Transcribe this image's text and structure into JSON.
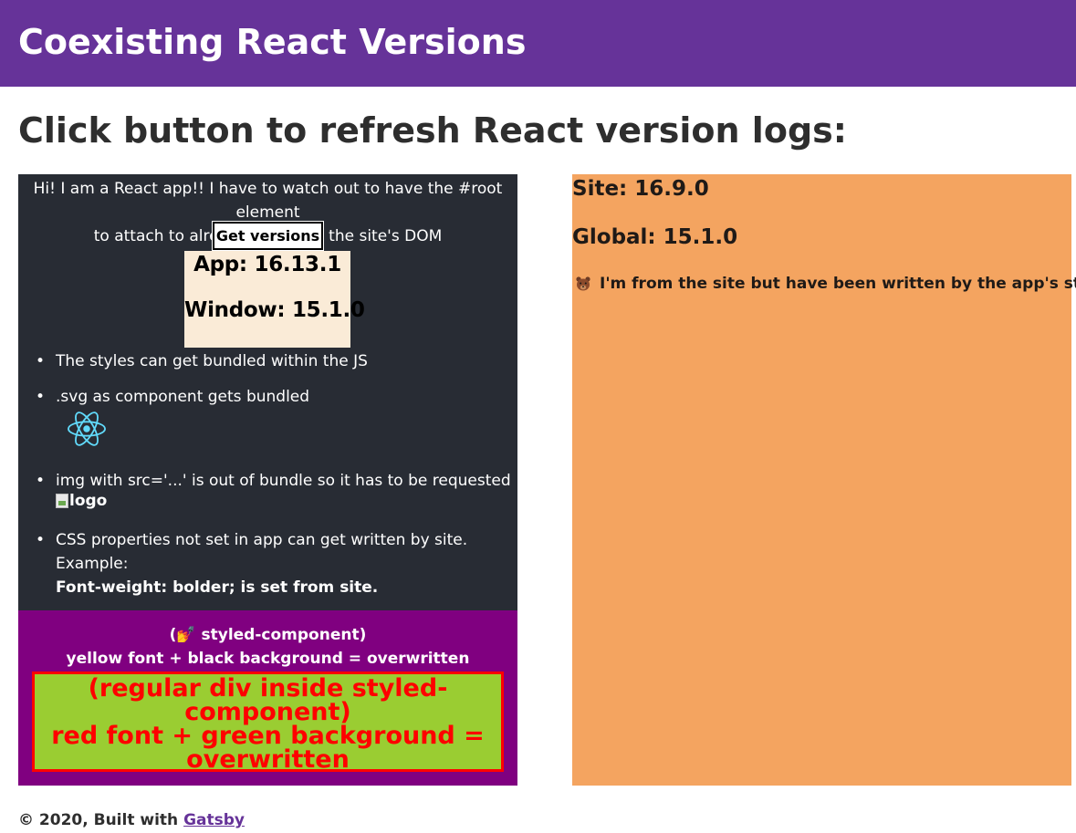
{
  "header": {
    "title": "Coexisting React Versions",
    "background": "#663399"
  },
  "main": {
    "heading": "Click button to refresh React version logs:"
  },
  "app": {
    "intro_line1": "Hi! I am a React app!! I have to watch out to have the #root element",
    "intro_line2": "to attach to already loaded in the site's DOM",
    "button_label": "Get versions",
    "versions": {
      "app": "App: 16.13.1",
      "window": "Window: 15.1.0"
    },
    "features": [
      {
        "text": "The styles can get bundled within the JS"
      },
      {
        "text": ".svg as component gets bundled",
        "icon": "react-logo-icon"
      },
      {
        "text": "img with src='...' is out of bundle so it has to be requested",
        "img_alt": "logo"
      },
      {
        "text": "CSS properties not set in app can get written by site. Example:",
        "bold": "Font-weight: bolder; is set from site."
      }
    ],
    "bullet": "•",
    "background": "#282c34"
  },
  "styled_component": {
    "line1": "(💅 styled-component)",
    "line2": "yellow font + black background = overwritten",
    "regular_div": {
      "line1": "(regular div inside styled-",
      "line2": "component)",
      "line3": "red font + green background =",
      "line4": "overwritten"
    },
    "background": "#800080"
  },
  "site": {
    "site_version": "Site: 16.9.0",
    "global_version": "Global: 15.1.0",
    "note": "I'm from the site but have been written by the app's styles",
    "note_icon": "bear-icon",
    "background": "#f4a460"
  },
  "footer": {
    "prefix": "© 2020, Built with",
    "link_label": "Gatsby"
  }
}
